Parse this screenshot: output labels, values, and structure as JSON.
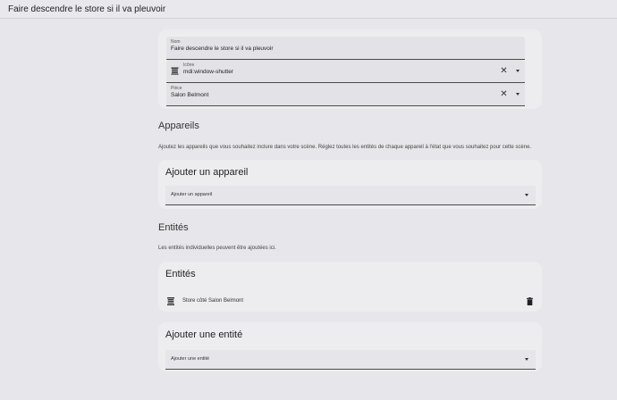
{
  "header": {
    "title": "Faire descendre le store si il va pleuvoir"
  },
  "form": {
    "name": {
      "label": "Nom",
      "value": "Faire descendre le store si il va pleuvoir"
    },
    "icon": {
      "label": "Icône",
      "value": "mdi:window-shutter",
      "icon": "window-shutter-icon"
    },
    "room": {
      "label": "Pièce",
      "value": "Salon Belmont"
    },
    "clear_symbol": "✕"
  },
  "devices": {
    "title": "Appareils",
    "description": "Ajoutez les appareils que vous souhaitez inclure dans votre scène. Réglez toutes les entités de chaque appareil à l'état que vous souhaitez pour cette scène.",
    "card_title": "Ajouter un appareil",
    "picker_label": "Ajouter un appareil"
  },
  "entities": {
    "title": "Entités",
    "description": "Les entités individuelles peuvent être ajoutées ici.",
    "card_title": "Entités",
    "items": [
      {
        "name": "Store côté Salon Belmont",
        "icon": "window-shutter-icon"
      }
    ],
    "add_card_title": "Ajouter une entité",
    "picker_label": "Ajouter une entité"
  },
  "colors": {
    "background": "#e7e6ea",
    "card": "#ededf0",
    "text": "#212121"
  }
}
